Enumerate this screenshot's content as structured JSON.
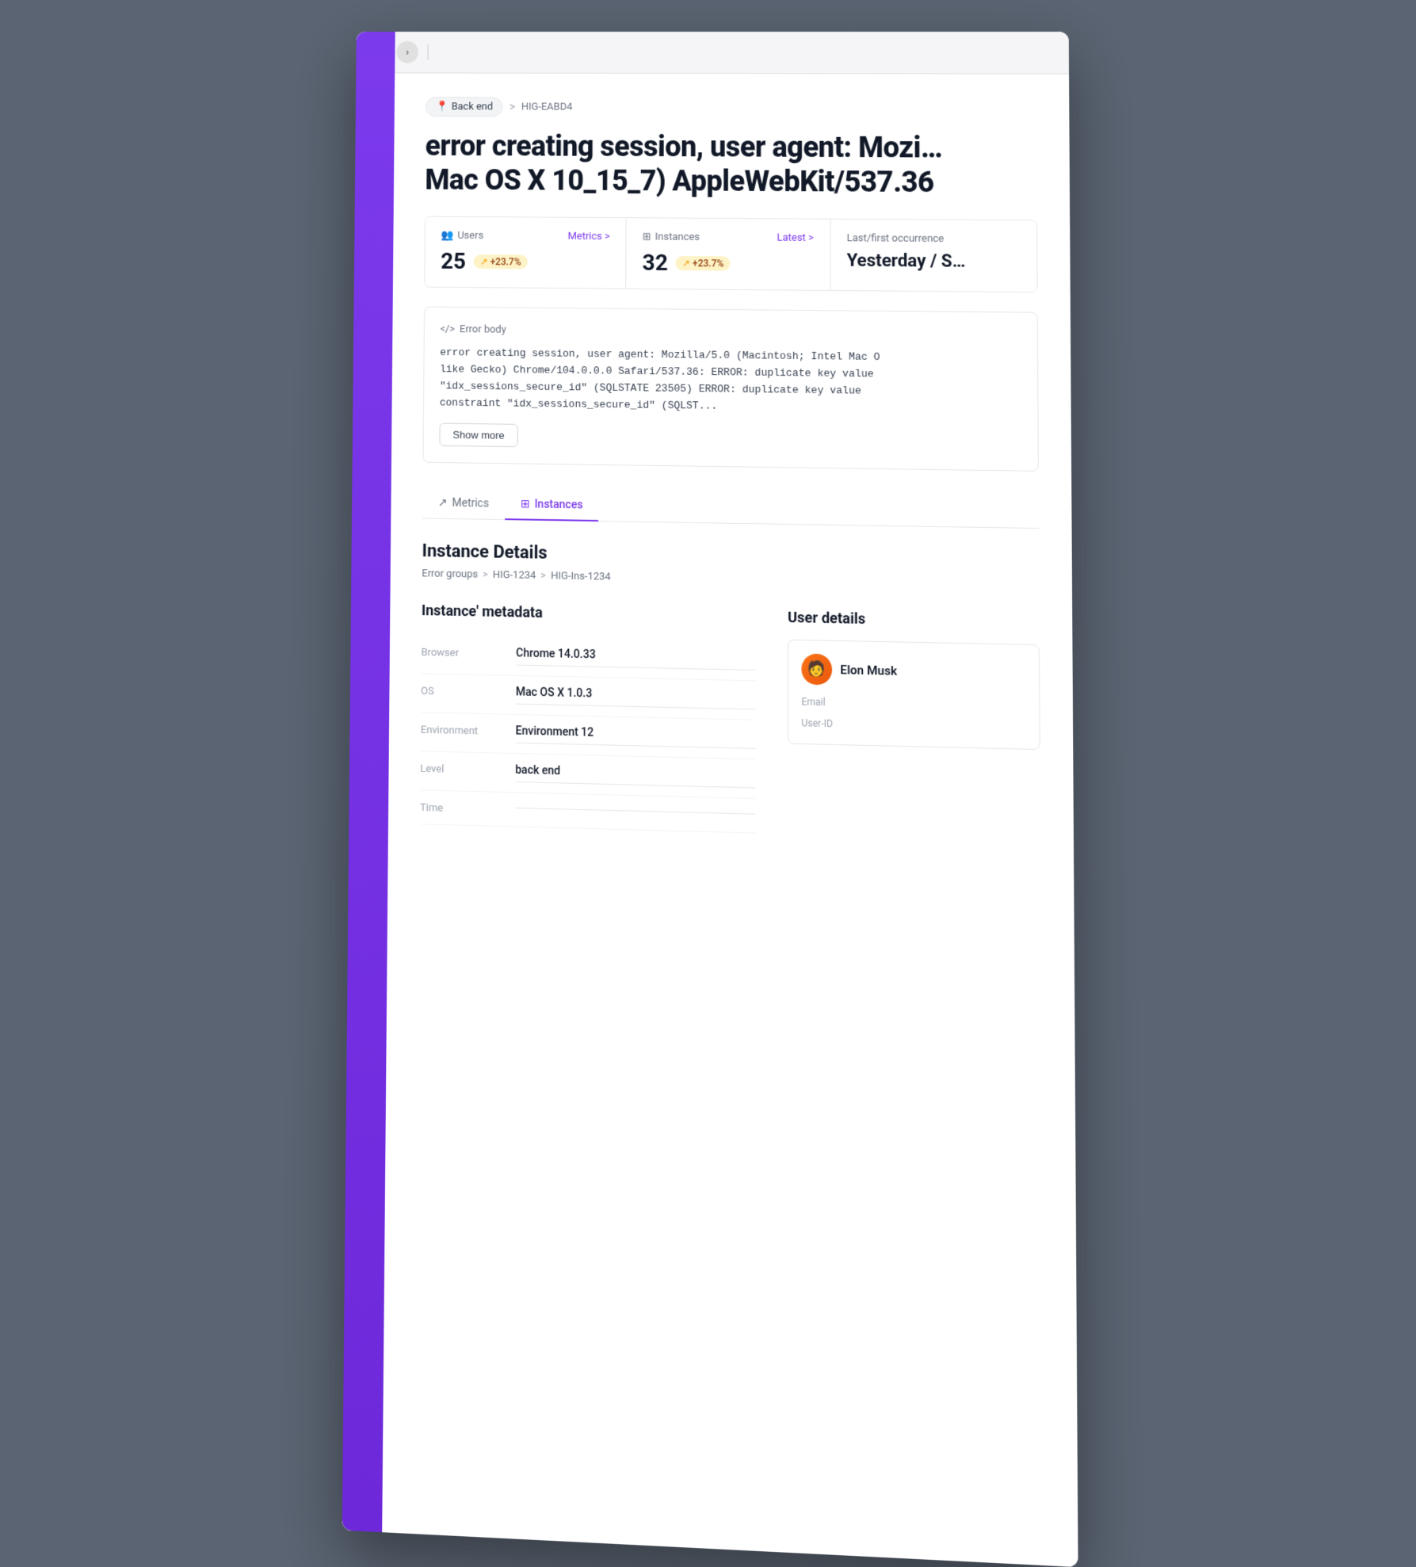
{
  "browser": {
    "nav_back": "‹",
    "nav_forward": "›"
  },
  "breadcrumb": {
    "tag_icon": "📍",
    "tag_label": "Back end",
    "separator": ">",
    "current": "HIG-EABD4"
  },
  "error_title": "error creating session, user agent: Mozilla/5.0 (Macintosh; Intel Mac OS X 10_15_7) AppleWebKit/537.36",
  "error_title_display": "error creating session, user agent: Mozi… Mac OS X 10_15_7) AppleWebKit/537.36",
  "stats": {
    "users": {
      "label": "Users",
      "value": "25",
      "badge": "+23.7%",
      "link": "Metrics >"
    },
    "instances": {
      "label": "Instances",
      "value": "32",
      "badge": "+23.7%",
      "link": "Latest >"
    },
    "occurrence": {
      "label": "Last/first occurrence",
      "value": "Yesterday / S…"
    }
  },
  "error_body": {
    "label": "</> Error body",
    "code": "error creating session, user agent: Mozilla/5.0 (Macintosh; Intel Mac O\nlike Gecko) Chrome/104.0.0.0 Safari/537.36: ERROR: duplicate key value\n\"idx_sessions_secure_id\" (SQLSTATE 23505) ERROR: duplicate key value\nconstraint \"idx_sessions_secure_id\" (SQLST...",
    "show_more": "Show more"
  },
  "tabs": {
    "metrics": {
      "label": "Metrics",
      "icon": "↗"
    },
    "instances": {
      "label": "Instances",
      "icon": "⊞"
    }
  },
  "instance_details": {
    "title": "Instance Details",
    "breadcrumb": {
      "part1": "Error groups",
      "sep1": ">",
      "part2": "HIG-1234",
      "sep2": ">",
      "part3": "HIG-Ins-1234"
    }
  },
  "metadata": {
    "title": "Instance' metadata",
    "fields": [
      {
        "key": "Browser",
        "value": "Chrome 14.0.33"
      },
      {
        "key": "OS",
        "value": "Mac OS X 1.0.3"
      },
      {
        "key": "Environment",
        "value": "Environment 12"
      },
      {
        "key": "Level",
        "value": "back end"
      },
      {
        "key": "Time",
        "value": ""
      }
    ]
  },
  "user_details": {
    "title": "User details",
    "user": {
      "name": "Elon Musk",
      "avatar_emoji": "🧑"
    },
    "fields": [
      {
        "label": "Email",
        "value": ""
      },
      {
        "label": "User-ID",
        "value": ""
      }
    ]
  }
}
